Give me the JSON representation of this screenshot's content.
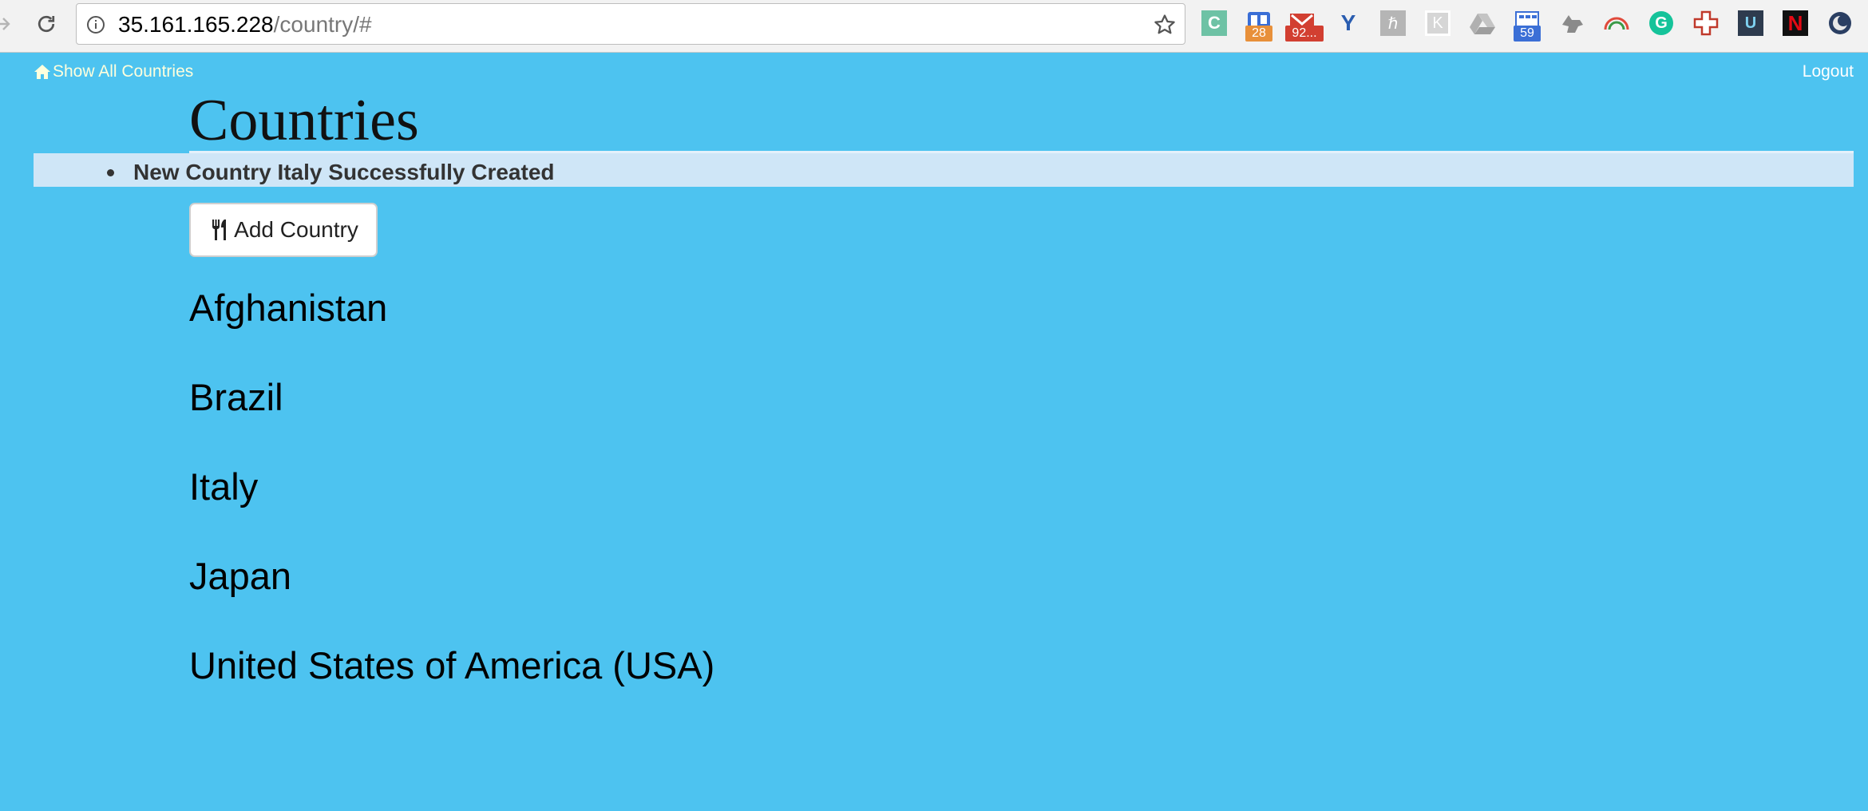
{
  "browser": {
    "url_host": "35.161.165.228",
    "url_path": "/country/#",
    "extensions": [
      {
        "name": "c-icon",
        "label": "C",
        "color": "#6ec2a5"
      },
      {
        "name": "trello-icon",
        "badge": "28",
        "badge_color": "#e8903a"
      },
      {
        "name": "gmail-icon",
        "badge": "92...",
        "badge_color": "#d23f31"
      },
      {
        "name": "y-icon",
        "label": "Y"
      },
      {
        "name": "hiragana-icon"
      },
      {
        "name": "k-icon",
        "label": "K"
      },
      {
        "name": "drive-icon"
      },
      {
        "name": "calendar-icon",
        "badge": "59",
        "badge_color": "#3b6fd6"
      },
      {
        "name": "dog-icon"
      },
      {
        "name": "rainbow-icon"
      },
      {
        "name": "grammarly-icon",
        "label": "G"
      },
      {
        "name": "plus-cross-icon"
      },
      {
        "name": "u-icon",
        "label": "U"
      },
      {
        "name": "netflix-icon",
        "label": "N"
      },
      {
        "name": "moon-icon"
      }
    ]
  },
  "nav": {
    "home_label": "Show All Countries",
    "logout_label": "Logout"
  },
  "page": {
    "title": "Countries",
    "flash_message": "New Country Italy Successfully Created",
    "add_button_label": "Add Country"
  },
  "countries": [
    "Afghanistan",
    "Brazil",
    "Italy",
    "Japan",
    "United States of America (USA)"
  ],
  "colors": {
    "page_background": "#4dc3f0",
    "flash_background": "#cfe6f7",
    "home_link": "#ffffdd"
  }
}
